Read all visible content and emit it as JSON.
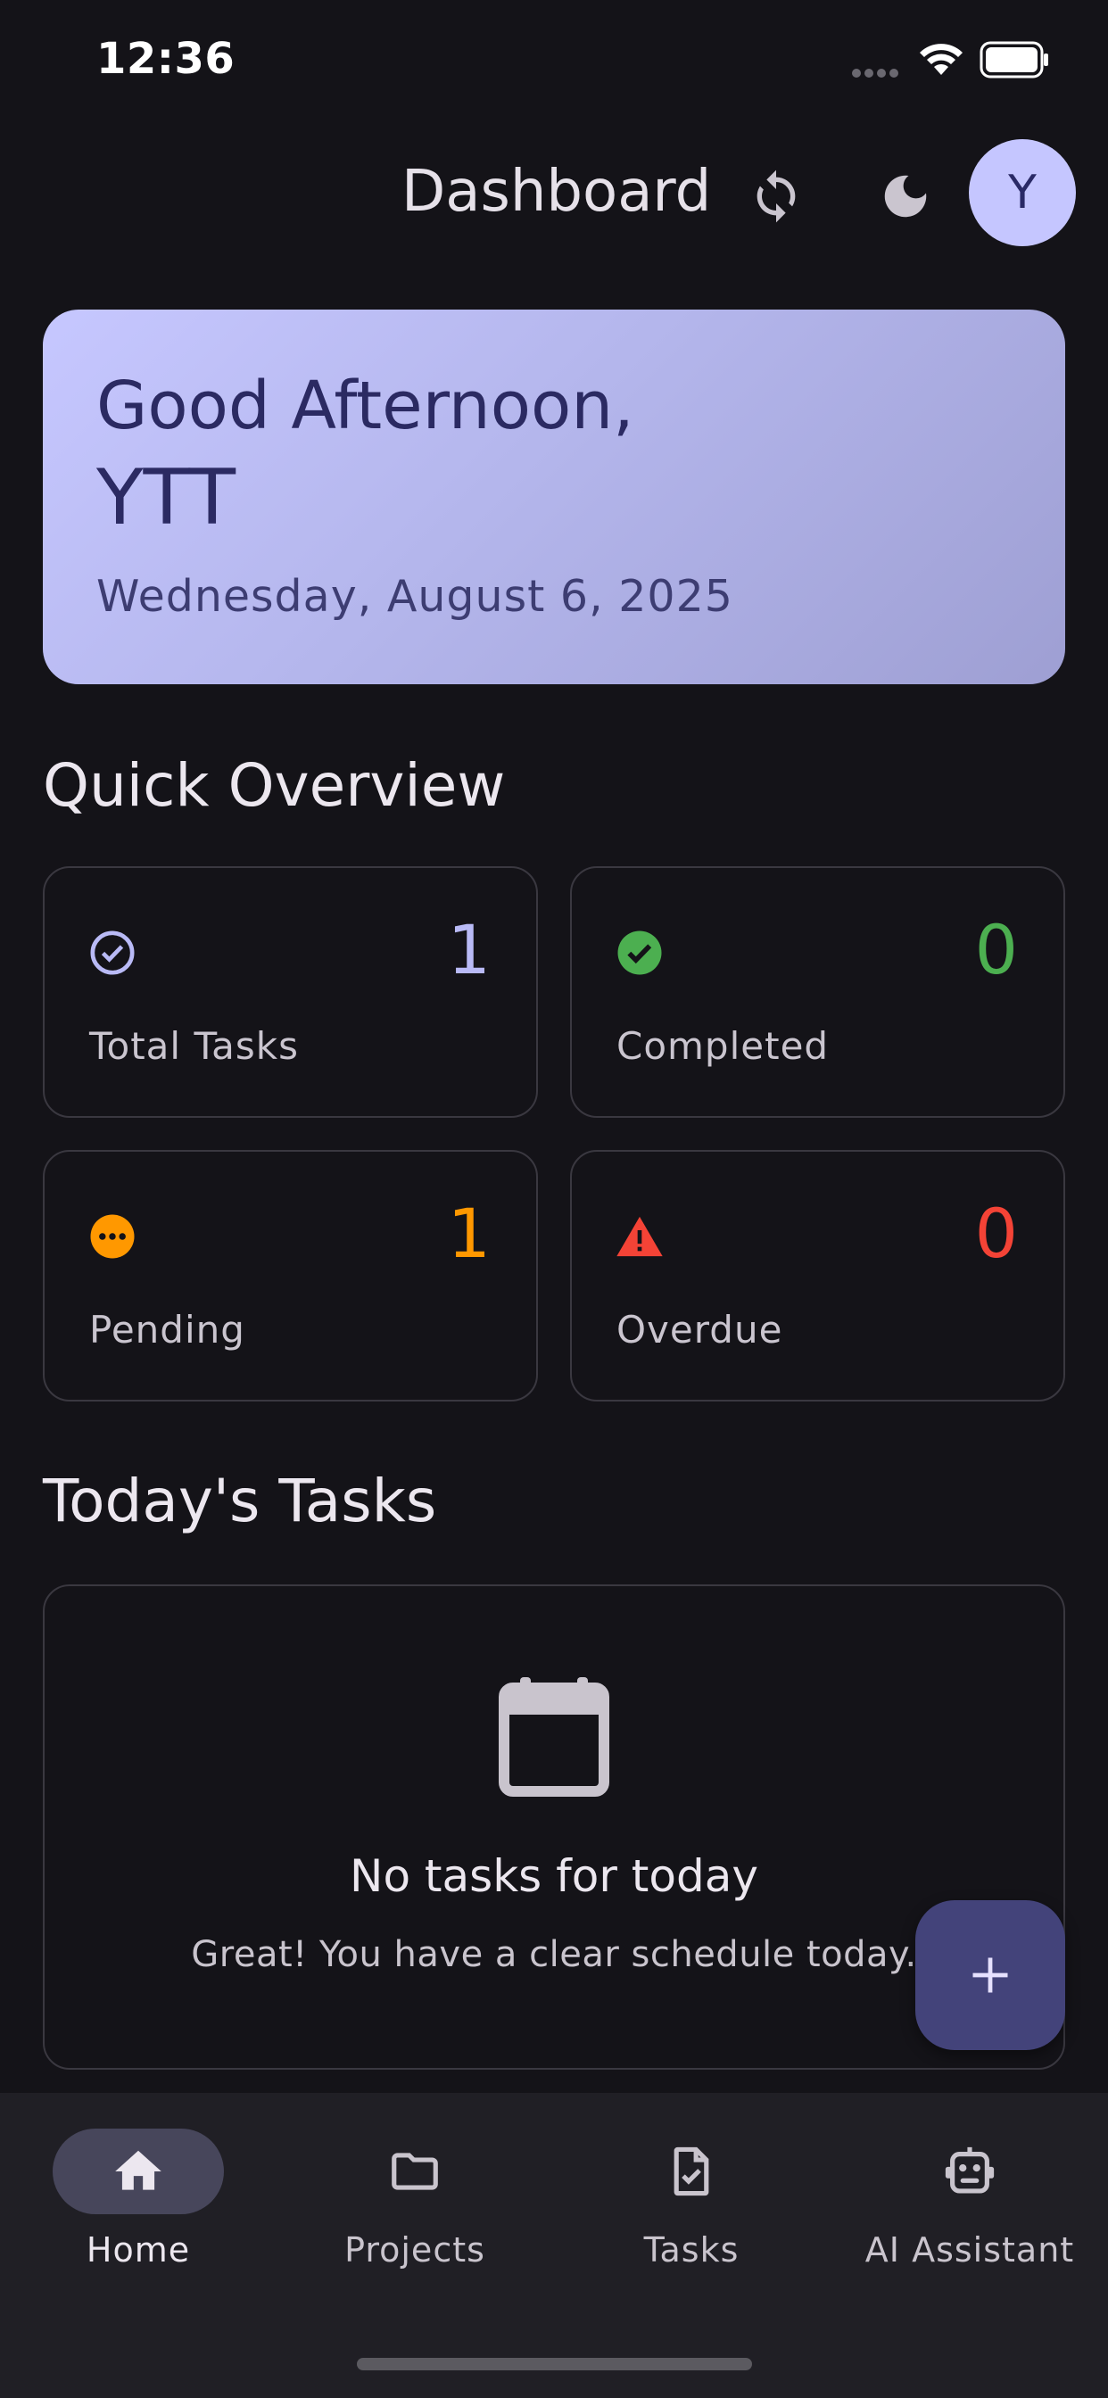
{
  "status_bar": {
    "time": "12:36"
  },
  "app_bar": {
    "title": "Dashboard",
    "avatar_initial": "Y"
  },
  "greeting": {
    "line1": "Good Afternoon,",
    "line2": "YTT",
    "date": "Wednesday, August 6, 2025"
  },
  "overview": {
    "title": "Quick Overview",
    "stats": [
      {
        "label": "Total Tasks",
        "value": "1",
        "icon": "check-circle-outline-icon",
        "color": "#b9baf6"
      },
      {
        "label": "Completed",
        "value": "0",
        "icon": "check-circle-filled-icon",
        "color": "#4caf50"
      },
      {
        "label": "Pending",
        "value": "1",
        "icon": "more-horiz-circle-icon",
        "color": "#ff9800"
      },
      {
        "label": "Overdue",
        "value": "0",
        "icon": "warning-triangle-icon",
        "color": "#f44336"
      }
    ]
  },
  "today": {
    "title": "Today's Tasks",
    "empty_title": "No tasks for today",
    "empty_subtitle": "Great! You have a clear schedule today."
  },
  "fab": {
    "icon": "plus-icon"
  },
  "nav": {
    "items": [
      {
        "label": "Home",
        "icon": "home-icon",
        "active": true
      },
      {
        "label": "Projects",
        "icon": "folder-icon",
        "active": false
      },
      {
        "label": "Tasks",
        "icon": "task-file-icon",
        "active": false
      },
      {
        "label": "AI Assistant",
        "icon": "robot-icon",
        "active": false
      }
    ]
  }
}
